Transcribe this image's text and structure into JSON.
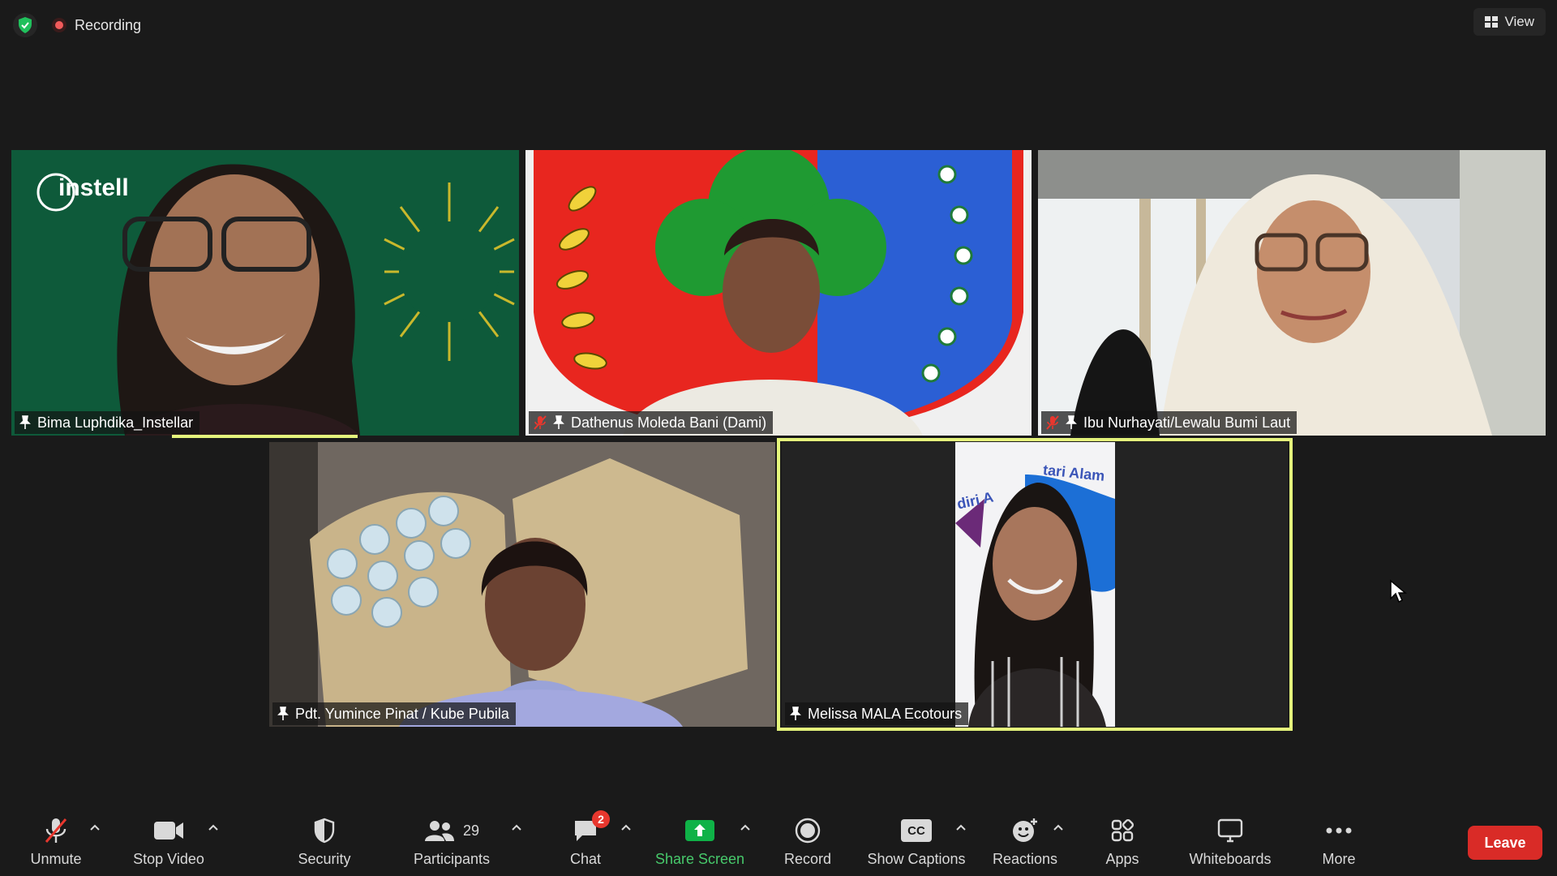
{
  "top_bar": {
    "recording_label": "Recording",
    "view_label": "View"
  },
  "participants": [
    {
      "name": "Bima Luphdika_Instellar",
      "muted": false,
      "brand_text": "instell"
    },
    {
      "name": "Dathenus Moleda Bani (Dami)",
      "muted": true
    },
    {
      "name": "Ibu Nurhayati/Lewalu Bumi Laut",
      "muted": true
    },
    {
      "name": "Pdt. Yumince Pinat / Kube Pubila",
      "muted": false
    },
    {
      "name": "Melissa MALA Ecotours",
      "muted": false,
      "active_speaker": true,
      "background_text": "tari Alam",
      "background_text_2": "diri A"
    }
  ],
  "toolbar": {
    "unmute": "Unmute",
    "stop_video": "Stop Video",
    "security": "Security",
    "participants": "Participants",
    "participants_count": "29",
    "chat": "Chat",
    "chat_badge": "2",
    "share_screen": "Share Screen",
    "record": "Record",
    "show_captions": "Show Captions",
    "captions_icon_text": "CC",
    "reactions": "Reactions",
    "apps": "Apps",
    "whiteboards": "Whiteboards",
    "more": "More",
    "leave": "Leave"
  },
  "colors": {
    "accent_speaking": "#e5f57c",
    "share_green": "#0fb247",
    "leave_red": "#d92b27",
    "background": "#1a1a1a"
  }
}
